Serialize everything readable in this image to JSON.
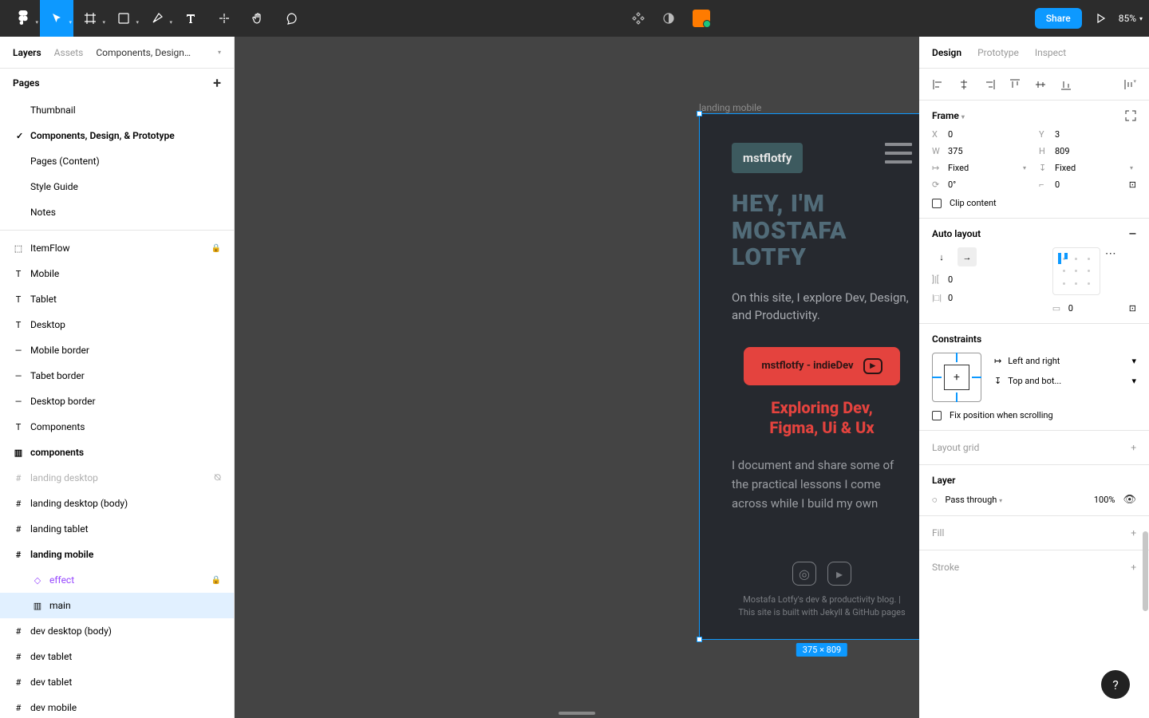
{
  "toolbar": {
    "share_label": "Share",
    "zoom": "85%"
  },
  "leftPanel": {
    "tabs": {
      "layers": "Layers",
      "assets": "Assets"
    },
    "pageTitle": "Components, Design, & Pr...",
    "pagesHeader": "Pages",
    "pages": [
      "Thumbnail",
      "Components, Design, & Prototype",
      "Pages (Content)",
      "Style Guide",
      "Notes"
    ],
    "layers": {
      "itemflow": "ItemFlow",
      "mobile": "Mobile",
      "tablet": "Tablet",
      "desktop": "Desktop",
      "mobile_border": "Mobile border",
      "tablet_border": "Tabet border",
      "desktop_border": "Desktop border",
      "components_t": "Components",
      "components_f": "components",
      "landing_desktop": "landing desktop",
      "landing_desktop_body": "landing desktop (body)",
      "landing_tablet": "landing tablet",
      "landing_mobile": "landing mobile",
      "effect": "effect",
      "main_inst": "main",
      "dev_desktop_body": "dev desktop (body)",
      "dev_tablet1": "dev tablet",
      "dev_tablet2": "dev tablet",
      "dev_mobile": "dev mobile"
    }
  },
  "canvas": {
    "frameLabel": "landing mobile",
    "dimBadge": "375 × 809",
    "artboard": {
      "logo": "mstflotfy",
      "hero_h1": "HEY, I'M",
      "hero_h2": "MOSTAFA",
      "hero_h3": "LOTFY",
      "intro": "On this site, I explore Dev, Design, and Productivity.",
      "yt_label": "mstflotfy - indieDev",
      "sub_h1": "Exploring Dev,",
      "sub_h2": "Figma, Ui & Ux",
      "body": "I document and share some of the practical lessons I come across while I build my own",
      "footer1": "Mostafa Lotfy's dev & productivity blog. |",
      "footer2": "This site is built with Jekyll & GitHub pages"
    }
  },
  "rightPanel": {
    "tabs": {
      "design": "Design",
      "prototype": "Prototype",
      "inspect": "Inspect"
    },
    "frameHeader": "Frame",
    "x": "0",
    "y": "3",
    "w": "375",
    "h": "809",
    "w_mode": "Fixed",
    "h_mode": "Fixed",
    "rotation": "0°",
    "corner": "0",
    "clip": "Clip content",
    "autoLayoutHeader": "Auto layout",
    "gap": "0",
    "pad_h": "0",
    "pad_v": "0",
    "constraintsHeader": "Constraints",
    "cons_h": "Left and right",
    "cons_v": "Top and bot...",
    "fix_scroll": "Fix position when scrolling",
    "layoutGrid": "Layout grid",
    "layerHeader": "Layer",
    "blend": "Pass through",
    "opacity": "100%",
    "fill": "Fill",
    "stroke": "Stroke"
  },
  "help": "?"
}
